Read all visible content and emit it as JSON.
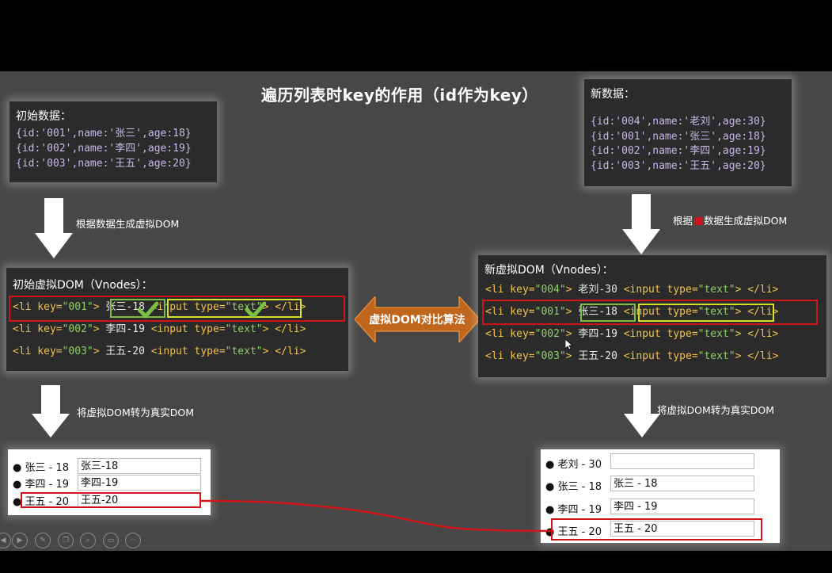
{
  "title": "遍历列表时key的作用（id作为key）",
  "initial_data": {
    "heading": "初始数据：",
    "rows": [
      "{id:'001',name:'张三',age:18}",
      "{id:'002',name:'李四',age:19}",
      "{id:'003',name:'王五',age:20}"
    ]
  },
  "new_data": {
    "heading": "新数据：",
    "rows": [
      "{id:'004',name:'老刘',age:30}",
      "{id:'001',name:'张三',age:18}",
      "{id:'002',name:'李四',age:19}",
      "{id:'003',name:'王五',age:20}"
    ]
  },
  "labels": {
    "left_gen": "根据数据生成虚拟DOM",
    "right_gen_a": "根据",
    "right_gen_b": "数据生成虚拟DOM",
    "left_real": "将虚拟DOM转为真实DOM",
    "right_real": "将虚拟DOM转为真实DOM",
    "diff": "虚拟DOM对比算法"
  },
  "initial_vdom": {
    "heading": "初始虚拟DOM（Vnodes）：",
    "lines": [
      {
        "open": "<li key=",
        "key": "\"001\"",
        "gt": ">",
        "text": "张三-18",
        "inp": "<input type=",
        "type": "\"text\"",
        "end": "> </li>"
      },
      {
        "open": "<li key=",
        "key": "\"002\"",
        "gt": ">",
        "text": "李四-19",
        "inp": "<input type=",
        "type": "\"text\"",
        "end": "> </li>"
      },
      {
        "open": "<li key=",
        "key": "\"003\"",
        "gt": ">",
        "text": "王五-20",
        "inp": "<input type=",
        "type": "\"text\"",
        "end": "> </li>"
      }
    ]
  },
  "new_vdom": {
    "heading": "新虚拟DOM（Vnodes）：",
    "lines": [
      {
        "open": "<li key=",
        "key": "\"004\"",
        "gt": ">",
        "text": "老刘-30",
        "inp": "<input type=",
        "type": "\"text\"",
        "end": "> </li>"
      },
      {
        "open": "<li key=",
        "key": "\"001\"",
        "gt": ">",
        "text": "张三-18",
        "inp": "<input type=",
        "type": "\"text\"",
        "end": "> </li>"
      },
      {
        "open": "<li key=",
        "key": "\"002\"",
        "gt": ">",
        "text": "李四-19",
        "inp": "<input type=",
        "type": "\"text\"",
        "end": "> </li>"
      },
      {
        "open": "<li key=",
        "key": "\"003\"",
        "gt": ">",
        "text": "王五-20",
        "inp": "<input type=",
        "type": "\"text\"",
        "end": "> </li>"
      }
    ]
  },
  "initial_real": {
    "rows": [
      {
        "text": "张三 - 18",
        "value": "张三-18"
      },
      {
        "text": "李四 - 19",
        "value": "李四-19"
      },
      {
        "text": "王五 - 20",
        "value": "王五-20"
      }
    ]
  },
  "new_real": {
    "rows": [
      {
        "text": "老刘 - 30",
        "value": ""
      },
      {
        "text": "张三 - 18",
        "value": "张三 - 18"
      },
      {
        "text": "李四 - 19",
        "value": "李四 - 19"
      },
      {
        "text": "王五 - 20",
        "value": "王五 - 20"
      }
    ]
  },
  "colors": {
    "highlight": "#d0141a",
    "diff_arrow": "#c0651c",
    "check": "#7bbf45"
  },
  "controls": [
    "prev-icon",
    "play-icon",
    "pen-icon",
    "copy-icon",
    "zoom-icon",
    "subtitle-icon",
    "more-icon"
  ]
}
